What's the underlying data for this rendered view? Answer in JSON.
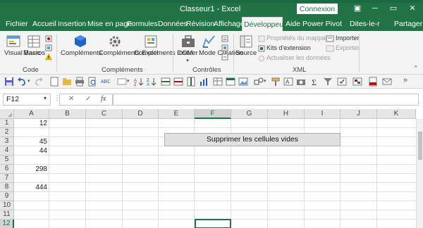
{
  "window": {
    "title": "Classeur1  -  Excel",
    "connexion_label": "Connexion",
    "minimize_glyph": "─",
    "restore_glyph": "▭",
    "close_glyph": "✕",
    "ribbon_display_glyph": "▣"
  },
  "tabs": [
    {
      "label": "Fichier"
    },
    {
      "label": "Accueil"
    },
    {
      "label": "Insertion"
    },
    {
      "label": "Mise en page"
    },
    {
      "label": "Formules"
    },
    {
      "label": "Données"
    },
    {
      "label": "Révision"
    },
    {
      "label": "Affichage"
    },
    {
      "label": "Développeur"
    },
    {
      "label": "Aide"
    },
    {
      "label": "Power Pivot"
    }
  ],
  "active_tab": "Développeur",
  "tell_me": "Dites-le-r",
  "share": "Partager",
  "ribbon": {
    "code": {
      "group_label": "Code",
      "visual_basic": "Visual Basic",
      "macros": "Macros"
    },
    "complements": {
      "group_label": "Compléments",
      "complements": "Compléments",
      "complements_excel": "Compléments Excel",
      "complements_com": "Compléments COM"
    },
    "controles": {
      "group_label": "Contrôles",
      "inserer": "Insérer",
      "mode_creation": "Mode Création"
    },
    "xml": {
      "group_label": "XML",
      "source": "Source",
      "proprietes_mappage": "Propriétés du mappage",
      "kits_extension": "Kits d'extension",
      "actualiser_donnees": "Actualiser les données",
      "importer": "Importer",
      "exporter": "Exporter"
    }
  },
  "formula_bar": {
    "name_box": "F12",
    "cancel": "✕",
    "enter": "✓",
    "fx": "fx",
    "formula": ""
  },
  "grid": {
    "columns": [
      "A",
      "B",
      "C",
      "D",
      "E",
      "F",
      "G",
      "H",
      "I",
      "J",
      "K"
    ],
    "selected_column": "F",
    "rows": [
      "1",
      "2",
      "3",
      "4",
      "5",
      "6",
      "7",
      "8",
      "9",
      "10",
      "11",
      "12"
    ],
    "selected_row": "12",
    "column_a_values": [
      "12",
      "",
      "45",
      "44",
      "",
      "298",
      "",
      "444",
      "",
      "",
      "",
      ""
    ],
    "macro_button_label": "Supprimer les cellules vides"
  },
  "colors": {
    "excel_green": "#217346",
    "ribbon_bg": "#f3f3f3",
    "header_bg": "#e6e6e6"
  }
}
